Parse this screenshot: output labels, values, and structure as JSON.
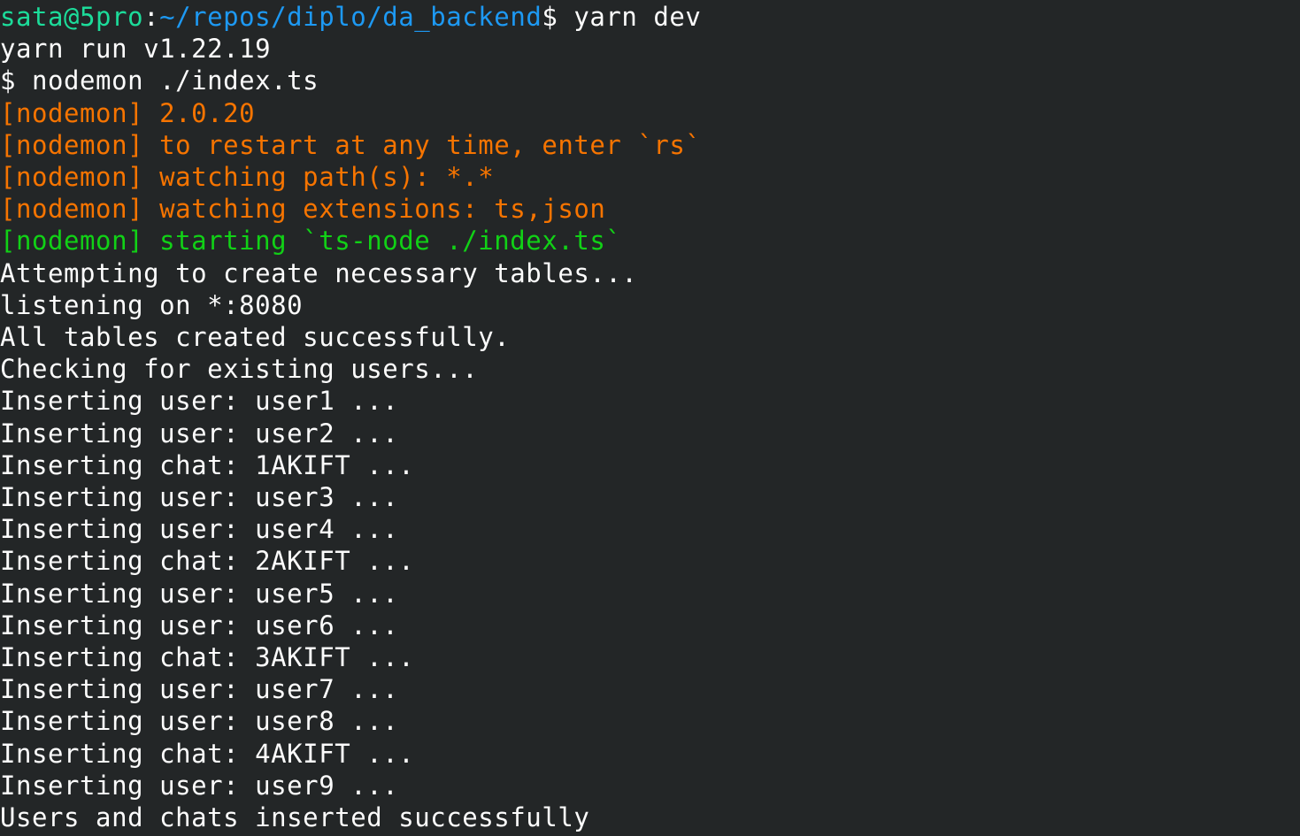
{
  "terminal": {
    "prompt": {
      "user_host": "sata@5pro",
      "separator": ":",
      "path": "~/repos/diplo/da_backend",
      "symbol": "$",
      "command": " yarn dev"
    },
    "lines": [
      "yarn run v1.22.19",
      "$ nodemon ./index.ts",
      "[nodemon] 2.0.20",
      "[nodemon] to restart at any time, enter `rs`",
      "[nodemon] watching path(s): *.*",
      "[nodemon] watching extensions: ts,json",
      "[nodemon] starting `ts-node ./index.ts`",
      "Attempting to create necessary tables...",
      "listening on *:8080",
      "All tables created successfully.",
      "Checking for existing users...",
      "Inserting user: user1 ...",
      "Inserting user: user2 ...",
      "Inserting chat: 1AKIFT ...",
      "Inserting user: user3 ...",
      "Inserting user: user4 ...",
      "Inserting chat: 2AKIFT ...",
      "Inserting user: user5 ...",
      "Inserting user: user6 ...",
      "Inserting chat: 3AKIFT ...",
      "Inserting user: user7 ...",
      "Inserting user: user8 ...",
      "Inserting chat: 4AKIFT ...",
      "Inserting user: user9 ...",
      "Users and chats inserted successfully"
    ]
  },
  "colors": {
    "background": "#232627",
    "foreground": "#fcfcfc",
    "prompt_user": "#1cdc9a",
    "prompt_path": "#1d99f3",
    "nodemon_info": "#f67400",
    "nodemon_start": "#11d116"
  }
}
